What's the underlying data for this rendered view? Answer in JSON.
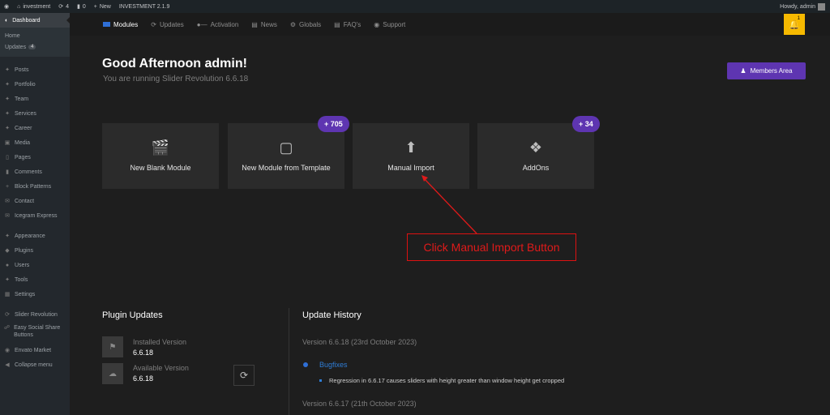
{
  "admin_bar": {
    "site": "investment",
    "updates_count": "4",
    "comments_count": "0",
    "new_label": "New",
    "theme_label": "INVESTMENT 2.1.9",
    "howdy": "Howdy, admin"
  },
  "sidebar": {
    "active": "Dashboard",
    "sub_home": "Home",
    "sub_updates": "Updates",
    "sub_updates_count": "4",
    "items": [
      "Posts",
      "Portfolio",
      "Team",
      "Services",
      "Career",
      "Media",
      "Pages",
      "Comments",
      "Block Patterns",
      "Contact",
      "Icegram Express",
      "Appearance",
      "Plugins",
      "Users",
      "Tools",
      "Settings",
      "Slider Revolution",
      "Easy Social Share Buttons",
      "Envato Market",
      "Collapse menu"
    ]
  },
  "topnav": {
    "tabs": [
      "Modules",
      "Updates",
      "Activation",
      "News",
      "Globals",
      "FAQ's",
      "Support"
    ],
    "notification_count": "1"
  },
  "main": {
    "greeting": "Good Afternoon admin!",
    "subtitle": "You are running Slider Revolution 6.6.18",
    "members_button": "Members Area",
    "cards": [
      "New Blank Module",
      "New Module from Template",
      "Manual Import",
      "AddOns"
    ],
    "template_badge": "+ 705",
    "addons_badge": "+ 34",
    "annotation": "Click Manual Import Button"
  },
  "plugin_updates": {
    "title": "Plugin Updates",
    "installed_label": "Installed Version",
    "installed_value": "6.6.18",
    "available_label": "Available Version",
    "available_value": "6.6.18"
  },
  "update_history": {
    "title": "Update History",
    "version_1": "Version 6.6.18 (23rd October 2023)",
    "bugfixes": "Bugfixes",
    "bug_1": "Regression in 6.6.17 causes sliders with height greater than window height get cropped",
    "version_2": "Version 6.6.17 (21th October 2023)"
  },
  "colors": {
    "accent_purple": "#5e35b1",
    "accent_blue": "#2f6fd6",
    "bell_yellow": "#f6b900",
    "annotation_red": "#e01a1a"
  }
}
